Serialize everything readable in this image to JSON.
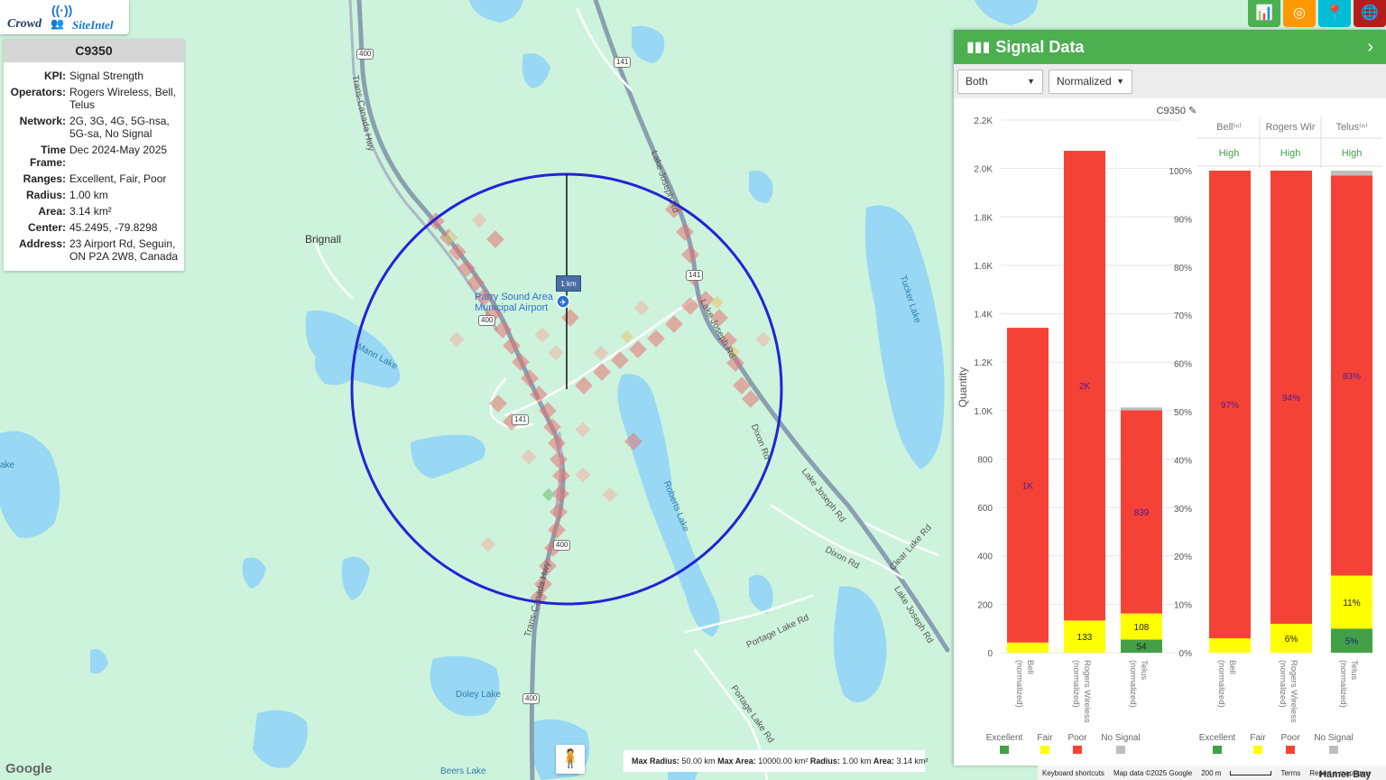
{
  "app": {
    "logo_text_1": "Crowd",
    "logo_text_2": "SiteIntel"
  },
  "info": {
    "title": "C9350",
    "rows": [
      {
        "key": "KPI:",
        "value": "Signal Strength"
      },
      {
        "key": "Operators:",
        "value": "Rogers Wireless, Bell, Telus"
      },
      {
        "key": "Network:",
        "value": "2G, 3G, 4G, 5G-nsa, 5G-sa, No Signal"
      },
      {
        "key": "Time Frame:",
        "value": "Dec 2024-May 2025"
      },
      {
        "key": "Ranges:",
        "value": "Excellent, Fair, Poor"
      },
      {
        "key": "Radius:",
        "value": "1.00 km"
      },
      {
        "key": "Area:",
        "value": "3.14 km²"
      },
      {
        "key": "Center:",
        "value": "45.2495, -79.8298"
      },
      {
        "key": "Address:",
        "value": "23 Airport Rd, Seguin, ON P2A 2W8, Canada"
      }
    ]
  },
  "top_buttons": [
    {
      "icon": "bar-chart-icon",
      "glyph": "📊",
      "color": "#4caf50"
    },
    {
      "icon": "target-icon",
      "glyph": "◎",
      "color": "#ff9800"
    },
    {
      "icon": "map-pin-icon",
      "glyph": "📍",
      "color": "#00bcd4"
    },
    {
      "icon": "globe-icon",
      "glyph": "🌐",
      "color": "#b71c1c"
    }
  ],
  "map": {
    "place_brignall": "Brignall",
    "airport_label_1": "Parry Sound Area",
    "airport_label_2": "Municipal Airport",
    "radius_badge": "1 km",
    "water_labels": {
      "mann": "Mann Lake",
      "tucker": "Tucker Lake",
      "roberts": "Roberts Lake",
      "doley": "Doley Lake",
      "beers": "Beers Lake",
      "lake_left": "ake"
    },
    "road_labels": {
      "tch_top": "Trans-Canada Hwy",
      "tch_bottom": "Trans-Canada Hwy",
      "lj_top": "Lake Joseph Rd",
      "lj_mid": "Lake Joseph Rd",
      "lj_right": "Lake Joseph Rd",
      "lj_low": "Lake Joseph Rd",
      "dixon_1": "Dixon Rd",
      "dixon_2": "Dixon Rd",
      "clear_lake": "Clear Lake Rd",
      "portage_1": "Portage Lake Rd",
      "portage_2": "Portage Lake Rd"
    },
    "shields": {
      "s400_top": "400",
      "s141_top": "141",
      "s141_mid": "141",
      "s400_mid": "400",
      "s141_low": "141",
      "s400_low": "400",
      "s400_bottom": "400"
    },
    "bottom_box": {
      "max_radius_label": "Max Radius:",
      "max_radius": "50.00 km",
      "max_area_label": "Max Area:",
      "max_area": "10000.00 km²",
      "radius_label": "Radius:",
      "radius": "1.00 km",
      "area_label": "Area:",
      "area": "3.14 km²"
    },
    "google": "Google",
    "footer": {
      "shortcuts": "Keyboard shortcuts",
      "map_data": "Map data ©2025 Google",
      "scale": "200 m",
      "terms": "Terms",
      "report": "Report a map error",
      "hamer": "Hamer Bay"
    }
  },
  "panel": {
    "title": "Signal Data",
    "dropdown_1": "Both",
    "dropdown_2": "Normalized",
    "chart_title": "C9350",
    "y_axis_label": "Quantity",
    "quality_headers": [
      "Bell⁽ⁿ⁾",
      "Rogers Wir",
      "Telus⁽ⁿ⁾"
    ],
    "quality_values": [
      "High",
      "High",
      "High"
    ],
    "legend": [
      "Excellent",
      "Fair",
      "Poor",
      "No Signal"
    ]
  },
  "colors": {
    "excellent": "#43a047",
    "fair": "#ffff00",
    "poor": "#f44336",
    "no_signal": "#bdbdbd",
    "circle": "#1f1fd6",
    "header_green": "#4caf50"
  },
  "chart_data": [
    {
      "type": "bar",
      "stacked": true,
      "title": "C9350",
      "ylabel": "Quantity",
      "ylim": [
        0,
        2200
      ],
      "yticks": [
        0,
        200,
        400,
        600,
        800,
        "1.0K",
        "1.2K",
        "1.4K",
        "1.6K",
        "1.8K",
        "2.0K",
        "2.2K"
      ],
      "categories": [
        "Bell (normalized)",
        "Rogers Wireless (normalized)",
        "Telus (normalized)"
      ],
      "series": [
        {
          "name": "Excellent",
          "values": [
            0,
            0,
            54
          ]
        },
        {
          "name": "Fair",
          "values": [
            42,
            133,
            108
          ]
        },
        {
          "name": "Poor",
          "values": [
            1300,
            1940,
            839
          ]
        },
        {
          "name": "No Signal",
          "values": [
            0,
            0,
            12
          ]
        }
      ],
      "labels": {
        "Poor": [
          "1K",
          "2K",
          "839"
        ],
        "Fair": [
          "",
          "133",
          "108"
        ],
        "Excellent": [
          "",
          "",
          "54"
        ]
      }
    },
    {
      "type": "bar",
      "stacked": true,
      "percent": true,
      "ylim": [
        0,
        100
      ],
      "yticks": [
        "0%",
        "10%",
        "20%",
        "30%",
        "40%",
        "50%",
        "60%",
        "70%",
        "80%",
        "90%",
        "100%"
      ],
      "categories": [
        "Bell (normalized)",
        "Rogers Wireless (normalized)",
        "Telus (normalized)"
      ],
      "series": [
        {
          "name": "Excellent",
          "values": [
            0,
            0,
            5
          ]
        },
        {
          "name": "Fair",
          "values": [
            3,
            6,
            11
          ]
        },
        {
          "name": "Poor",
          "values": [
            97,
            94,
            83
          ]
        },
        {
          "name": "No Signal",
          "values": [
            0,
            0,
            1
          ]
        }
      ],
      "labels": {
        "Poor": [
          "97%",
          "94%",
          "83%"
        ],
        "Fair": [
          "",
          "6%",
          "11%"
        ],
        "Excellent": [
          "",
          "",
          "5%"
        ]
      }
    }
  ]
}
